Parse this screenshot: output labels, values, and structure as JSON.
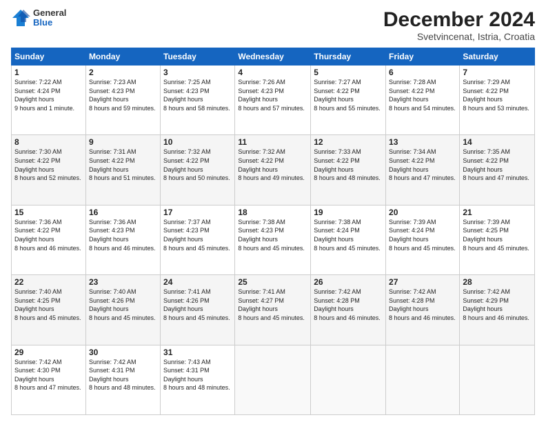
{
  "logo": {
    "general": "General",
    "blue": "Blue"
  },
  "title": "December 2024",
  "location": "Svetvincenat, Istria, Croatia",
  "days_of_week": [
    "Sunday",
    "Monday",
    "Tuesday",
    "Wednesday",
    "Thursday",
    "Friday",
    "Saturday"
  ],
  "weeks": [
    [
      {
        "day": "1",
        "sunrise": "7:22 AM",
        "sunset": "4:24 PM",
        "daylight": "9 hours and 1 minute."
      },
      {
        "day": "2",
        "sunrise": "7:23 AM",
        "sunset": "4:23 PM",
        "daylight": "8 hours and 59 minutes."
      },
      {
        "day": "3",
        "sunrise": "7:25 AM",
        "sunset": "4:23 PM",
        "daylight": "8 hours and 58 minutes."
      },
      {
        "day": "4",
        "sunrise": "7:26 AM",
        "sunset": "4:23 PM",
        "daylight": "8 hours and 57 minutes."
      },
      {
        "day": "5",
        "sunrise": "7:27 AM",
        "sunset": "4:22 PM",
        "daylight": "8 hours and 55 minutes."
      },
      {
        "day": "6",
        "sunrise": "7:28 AM",
        "sunset": "4:22 PM",
        "daylight": "8 hours and 54 minutes."
      },
      {
        "day": "7",
        "sunrise": "7:29 AM",
        "sunset": "4:22 PM",
        "daylight": "8 hours and 53 minutes."
      }
    ],
    [
      {
        "day": "8",
        "sunrise": "7:30 AM",
        "sunset": "4:22 PM",
        "daylight": "8 hours and 52 minutes."
      },
      {
        "day": "9",
        "sunrise": "7:31 AM",
        "sunset": "4:22 PM",
        "daylight": "8 hours and 51 minutes."
      },
      {
        "day": "10",
        "sunrise": "7:32 AM",
        "sunset": "4:22 PM",
        "daylight": "8 hours and 50 minutes."
      },
      {
        "day": "11",
        "sunrise": "7:32 AM",
        "sunset": "4:22 PM",
        "daylight": "8 hours and 49 minutes."
      },
      {
        "day": "12",
        "sunrise": "7:33 AM",
        "sunset": "4:22 PM",
        "daylight": "8 hours and 48 minutes."
      },
      {
        "day": "13",
        "sunrise": "7:34 AM",
        "sunset": "4:22 PM",
        "daylight": "8 hours and 47 minutes."
      },
      {
        "day": "14",
        "sunrise": "7:35 AM",
        "sunset": "4:22 PM",
        "daylight": "8 hours and 47 minutes."
      }
    ],
    [
      {
        "day": "15",
        "sunrise": "7:36 AM",
        "sunset": "4:22 PM",
        "daylight": "8 hours and 46 minutes."
      },
      {
        "day": "16",
        "sunrise": "7:36 AM",
        "sunset": "4:23 PM",
        "daylight": "8 hours and 46 minutes."
      },
      {
        "day": "17",
        "sunrise": "7:37 AM",
        "sunset": "4:23 PM",
        "daylight": "8 hours and 45 minutes."
      },
      {
        "day": "18",
        "sunrise": "7:38 AM",
        "sunset": "4:23 PM",
        "daylight": "8 hours and 45 minutes."
      },
      {
        "day": "19",
        "sunrise": "7:38 AM",
        "sunset": "4:24 PM",
        "daylight": "8 hours and 45 minutes."
      },
      {
        "day": "20",
        "sunrise": "7:39 AM",
        "sunset": "4:24 PM",
        "daylight": "8 hours and 45 minutes."
      },
      {
        "day": "21",
        "sunrise": "7:39 AM",
        "sunset": "4:25 PM",
        "daylight": "8 hours and 45 minutes."
      }
    ],
    [
      {
        "day": "22",
        "sunrise": "7:40 AM",
        "sunset": "4:25 PM",
        "daylight": "8 hours and 45 minutes."
      },
      {
        "day": "23",
        "sunrise": "7:40 AM",
        "sunset": "4:26 PM",
        "daylight": "8 hours and 45 minutes."
      },
      {
        "day": "24",
        "sunrise": "7:41 AM",
        "sunset": "4:26 PM",
        "daylight": "8 hours and 45 minutes."
      },
      {
        "day": "25",
        "sunrise": "7:41 AM",
        "sunset": "4:27 PM",
        "daylight": "8 hours and 45 minutes."
      },
      {
        "day": "26",
        "sunrise": "7:42 AM",
        "sunset": "4:28 PM",
        "daylight": "8 hours and 46 minutes."
      },
      {
        "day": "27",
        "sunrise": "7:42 AM",
        "sunset": "4:28 PM",
        "daylight": "8 hours and 46 minutes."
      },
      {
        "day": "28",
        "sunrise": "7:42 AM",
        "sunset": "4:29 PM",
        "daylight": "8 hours and 46 minutes."
      }
    ],
    [
      {
        "day": "29",
        "sunrise": "7:42 AM",
        "sunset": "4:30 PM",
        "daylight": "8 hours and 47 minutes."
      },
      {
        "day": "30",
        "sunrise": "7:42 AM",
        "sunset": "4:31 PM",
        "daylight": "8 hours and 48 minutes."
      },
      {
        "day": "31",
        "sunrise": "7:43 AM",
        "sunset": "4:31 PM",
        "daylight": "8 hours and 48 minutes."
      },
      null,
      null,
      null,
      null
    ]
  ],
  "labels": {
    "sunrise": "Sunrise:",
    "sunset": "Sunset:",
    "daylight": "Daylight hours"
  }
}
